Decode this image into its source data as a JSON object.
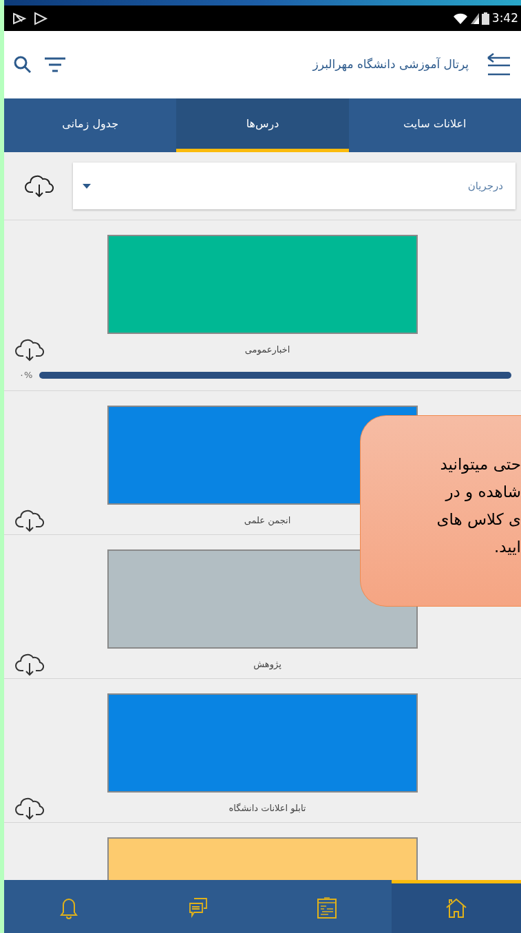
{
  "status_bar": {
    "time": "3:42"
  },
  "app_bar": {
    "title": "پرتال آموزشی دانشگاه مهرالبرز"
  },
  "tabs": [
    {
      "label": "اعلانات سایت",
      "selected": false
    },
    {
      "label": "درس‌ها",
      "selected": true
    },
    {
      "label": "جدول زمانی",
      "selected": false
    }
  ],
  "filter": {
    "value": "درجریان"
  },
  "courses": [
    {
      "label": "اخبارعمومی",
      "color": "#00b894",
      "progress": {
        "reading": "۰%",
        "level": 0
      }
    },
    {
      "label": "انجمن علمی",
      "color": "#0984e3"
    },
    {
      "label": "پژوهش",
      "color": "#b2bec3"
    },
    {
      "label": "تابلو اعلانات دانشگاه",
      "color": "#0984e3"
    },
    {
      "color": "#fdcb6e"
    }
  ],
  "callout": {
    "lines": [
      "حتی میتوانید",
      "شاهده و در",
      "ی کلاس های",
      "ایید."
    ]
  },
  "bottom_nav": [
    {
      "kind": "home",
      "selected": true
    },
    {
      "kind": "calendar",
      "selected": false
    },
    {
      "kind": "chat",
      "selected": false
    },
    {
      "kind": "bell",
      "selected": false
    }
  ]
}
